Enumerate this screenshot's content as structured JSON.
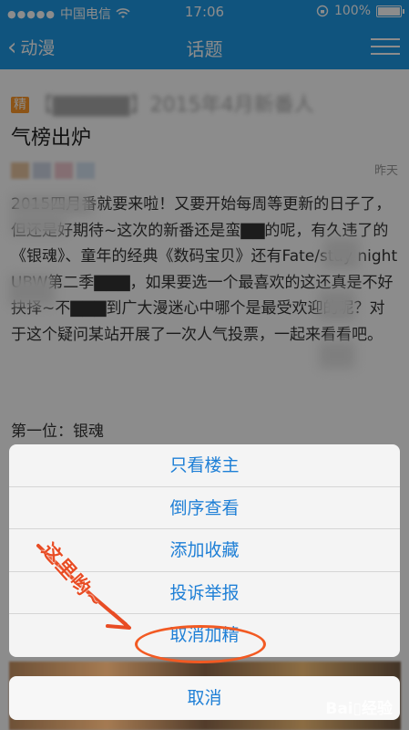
{
  "status_bar": {
    "carrier": "中国电信",
    "time": "17:06",
    "battery_label": "100%",
    "battery_level": 1.0
  },
  "nav": {
    "back_label": "动漫",
    "title": "话题"
  },
  "article": {
    "badge": "精",
    "title_blurred": "【▇▇▇▇▇】2015年4月新番人",
    "title_visible": "气榜出炉",
    "time": "昨天",
    "body": "2015四月番就要来啦！又要开始每周等更新的日子了，但还是好期待~这次的新番还是蛮▇▇的呢，有久违了的《银魂》、童年的经典《数码宝贝》还有Fate/stay night UBW第二季▇▇▇，如果要选一个最喜欢的这还真是不好抉择~不▇▇▇到广大漫迷心中哪个是最受欢迎的呢？对于这个疑问某站开展了一次人气投票，一起来看看吧。",
    "section_label": "第一位：银魂"
  },
  "action_sheet": {
    "items": [
      "只看楼主",
      "倒序查看",
      "添加收藏",
      "投诉举报",
      "取消加精"
    ],
    "cancel": "取消"
  },
  "annotation": {
    "text": "这里哟~",
    "color": "#e84c24"
  },
  "watermark": "Bai▯经验",
  "colors": {
    "nav_bg": "#1e9ae6",
    "action_text": "#1e7fd6",
    "badge": "#ff9a2b"
  },
  "icons": [
    "wifi-icon",
    "chevron-left-icon",
    "menu-icon",
    "lock-rotation-icon",
    "battery-icon"
  ]
}
